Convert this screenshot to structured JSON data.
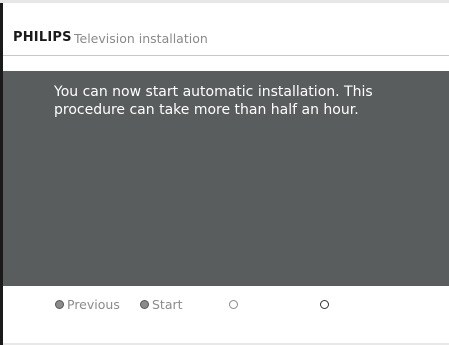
{
  "header": {
    "brand": "PHILIPS",
    "title": "Television installation"
  },
  "panel": {
    "message": "You can now start automatic installation. This procedure can take more than half an hour."
  },
  "footer": {
    "buttons": [
      {
        "label": "Previous",
        "icon": "filled-grey-circle"
      },
      {
        "label": "Start",
        "icon": "filled-grey-circle"
      },
      {
        "label": "",
        "icon": "hollow-grey-circle"
      },
      {
        "label": "",
        "icon": "hollow-circle"
      }
    ]
  },
  "colors": {
    "panel_background": "#5a5d5d",
    "brand_text": "#1a1a1a",
    "title_text": "#8a8a8a",
    "message_text": "#ffffff",
    "footer_text": "#8b8b8b"
  }
}
